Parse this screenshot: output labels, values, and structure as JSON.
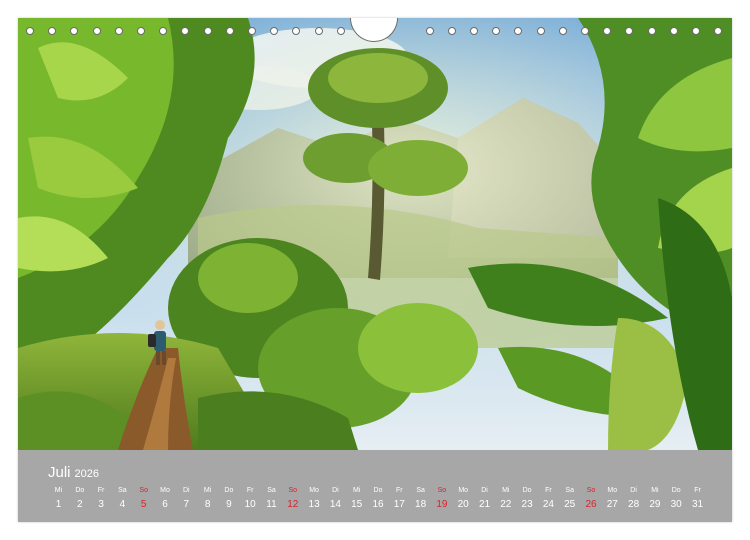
{
  "calendar": {
    "month": "Juli",
    "year": "2026",
    "days": [
      {
        "wd": "Mi",
        "d": "1"
      },
      {
        "wd": "Do",
        "d": "2"
      },
      {
        "wd": "Fr",
        "d": "3"
      },
      {
        "wd": "Sa",
        "d": "4"
      },
      {
        "wd": "So",
        "d": "5",
        "sunday": true
      },
      {
        "wd": "Mo",
        "d": "6"
      },
      {
        "wd": "Di",
        "d": "7"
      },
      {
        "wd": "Mi",
        "d": "8"
      },
      {
        "wd": "Do",
        "d": "9"
      },
      {
        "wd": "Fr",
        "d": "10"
      },
      {
        "wd": "Sa",
        "d": "11"
      },
      {
        "wd": "So",
        "d": "12",
        "sunday": true
      },
      {
        "wd": "Mo",
        "d": "13"
      },
      {
        "wd": "Di",
        "d": "14"
      },
      {
        "wd": "Mi",
        "d": "15"
      },
      {
        "wd": "Do",
        "d": "16"
      },
      {
        "wd": "Fr",
        "d": "17"
      },
      {
        "wd": "Sa",
        "d": "18"
      },
      {
        "wd": "So",
        "d": "19",
        "sunday": true
      },
      {
        "wd": "Mo",
        "d": "20"
      },
      {
        "wd": "Di",
        "d": "21"
      },
      {
        "wd": "Mi",
        "d": "22"
      },
      {
        "wd": "Do",
        "d": "23"
      },
      {
        "wd": "Fr",
        "d": "24"
      },
      {
        "wd": "Sa",
        "d": "25"
      },
      {
        "wd": "So",
        "d": "26",
        "sunday": true
      },
      {
        "wd": "Mo",
        "d": "27"
      },
      {
        "wd": "Di",
        "d": "28"
      },
      {
        "wd": "Mi",
        "d": "29"
      },
      {
        "wd": "Do",
        "d": "30"
      },
      {
        "wd": "Fr",
        "d": "31"
      }
    ]
  },
  "colors": {
    "strip": "#a7a7a7",
    "sunday": "#d8232a",
    "text": "#ffffff"
  },
  "photo": {
    "subject": "jungle-trail-photo"
  }
}
